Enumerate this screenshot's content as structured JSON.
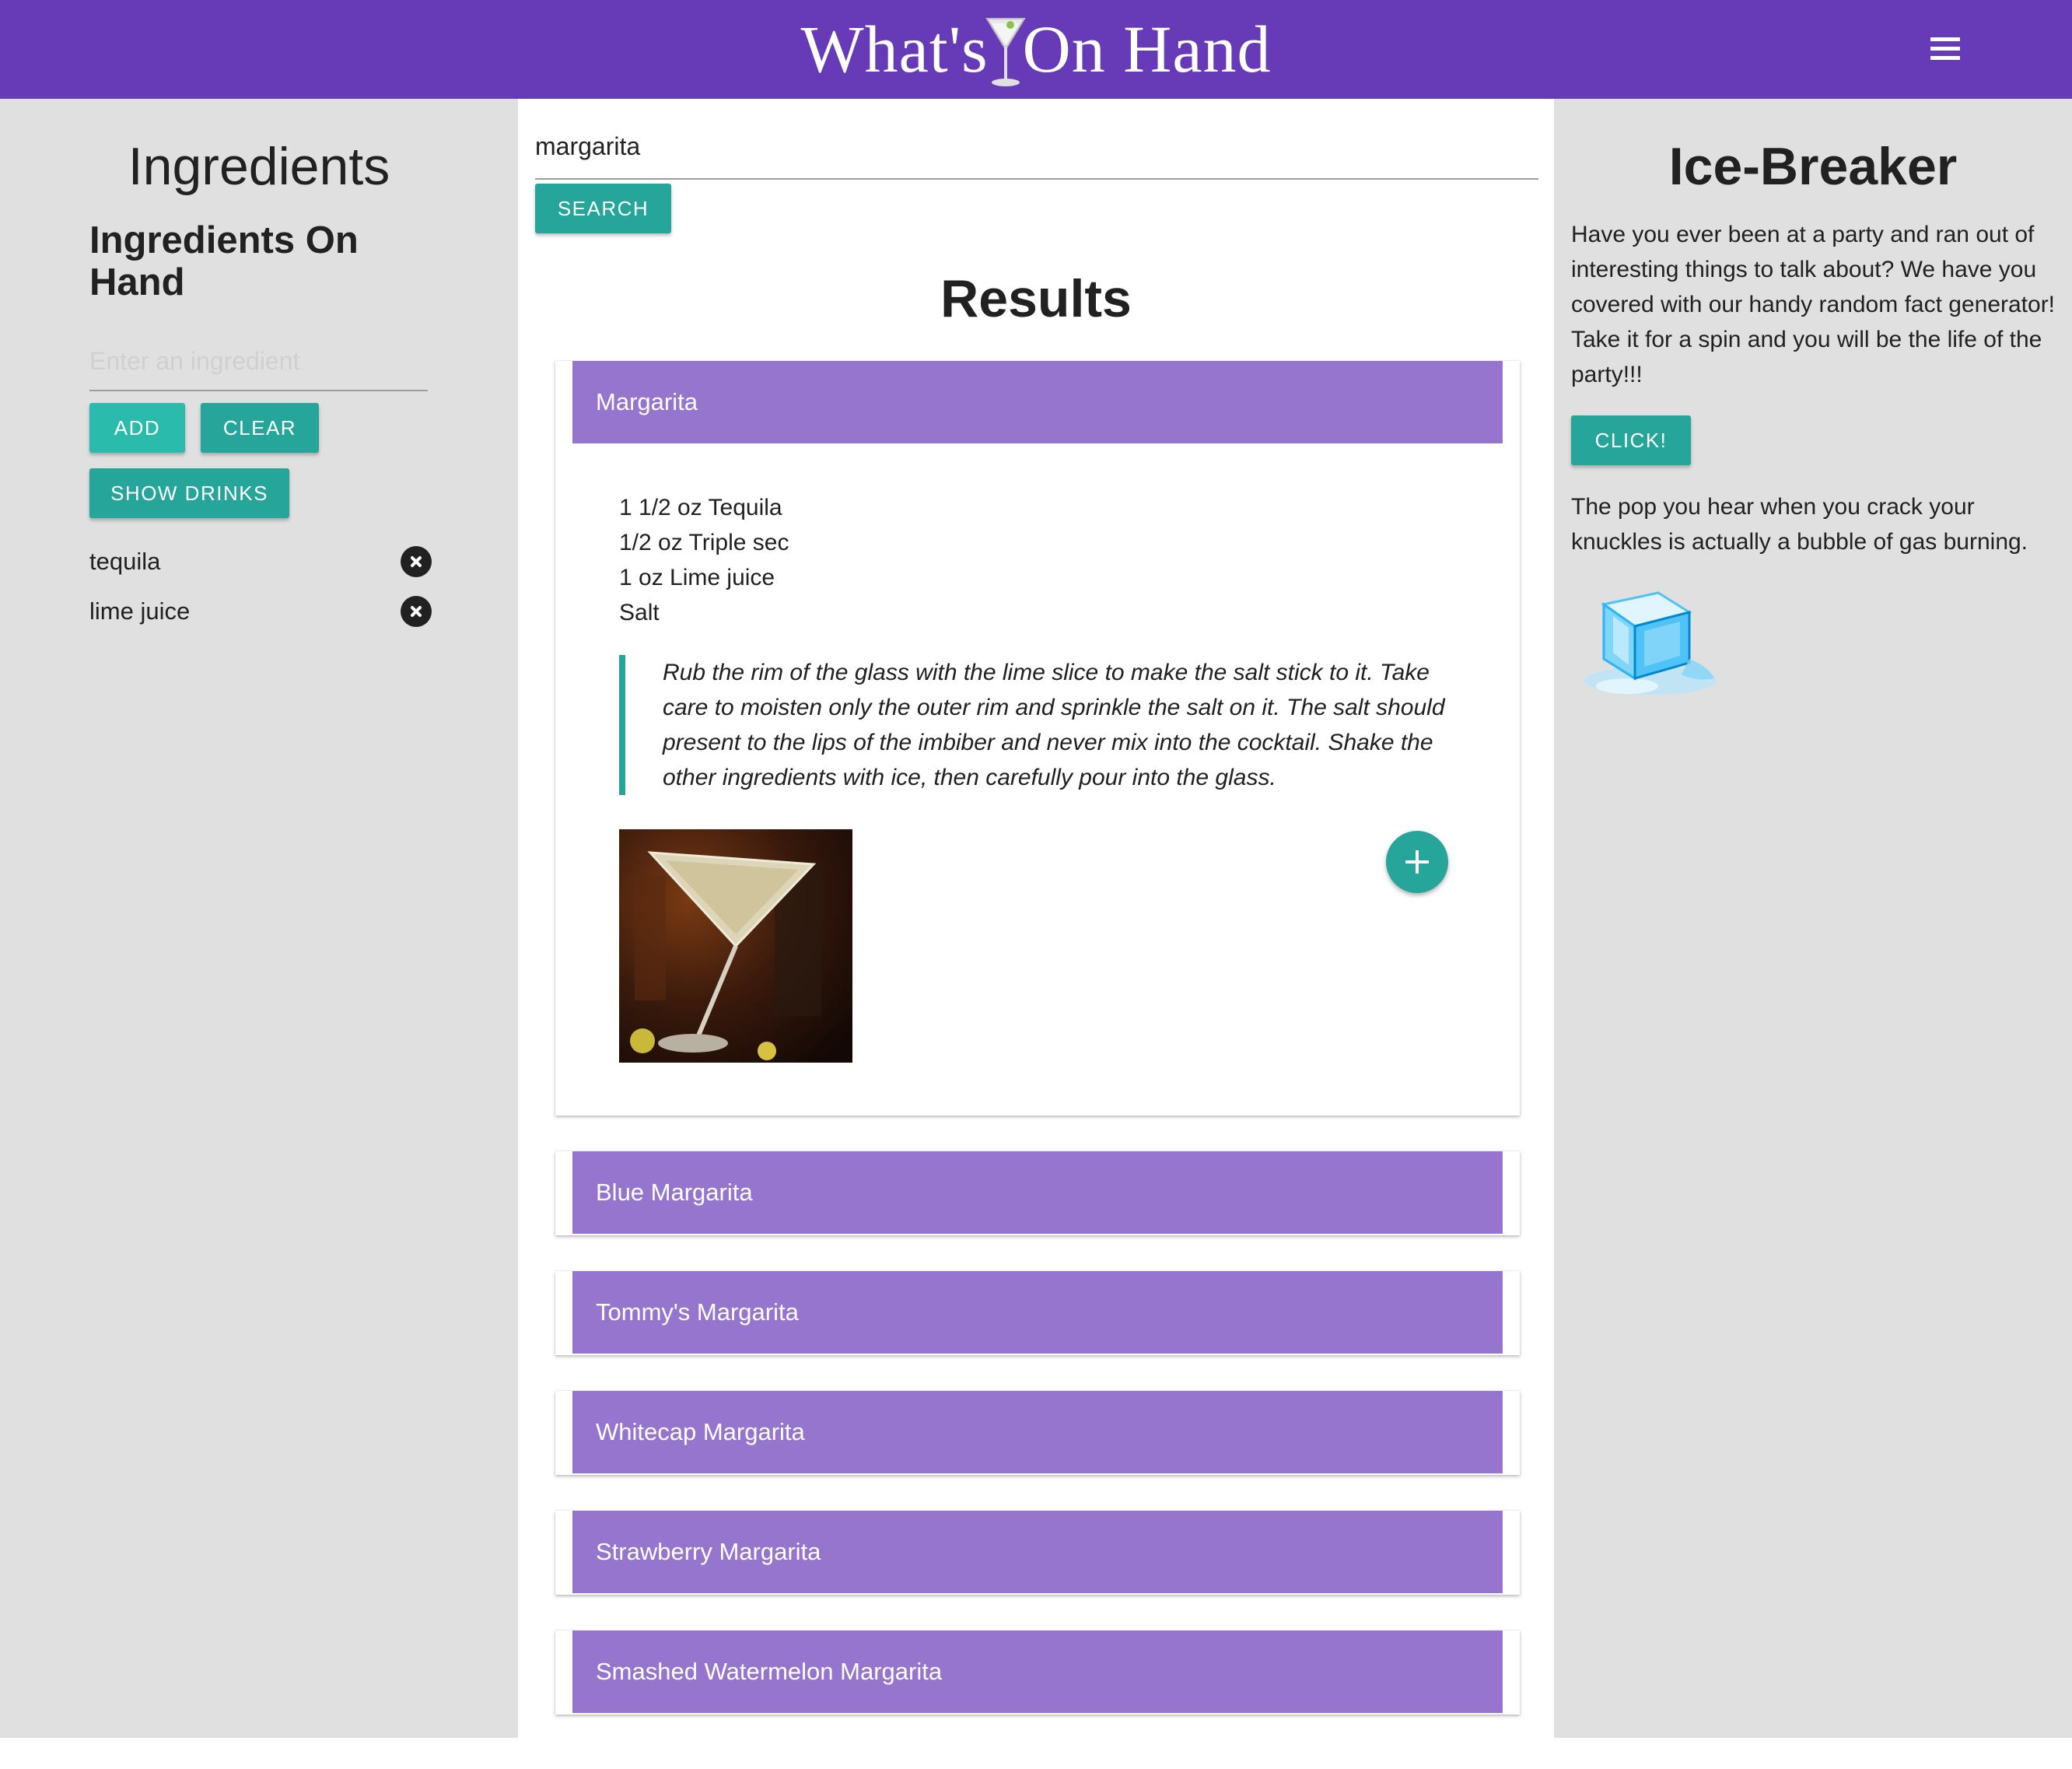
{
  "nav": {
    "brand_left": "What's",
    "brand_right": "On Hand",
    "logo_icon": "martini-glass-icon",
    "menu_icon": "hamburger-menu-icon"
  },
  "ingredients": {
    "title": "Ingredients",
    "subtitle": "Ingredients On Hand",
    "input_placeholder": "Enter an ingredient",
    "input_value": "",
    "add_label": "ADD",
    "clear_label": "CLEAR",
    "show_drinks_label": "SHOW DRINKS",
    "items": [
      {
        "label": "tequila"
      },
      {
        "label": "lime juice"
      }
    ]
  },
  "search": {
    "value": "margarita",
    "button_label": "SEARCH"
  },
  "results": {
    "title": "Results",
    "expanded": {
      "name": "Margarita",
      "ingredients": [
        "1 1/2 oz Tequila",
        "1/2 oz Triple sec",
        "1 oz Lime juice",
        "Salt"
      ],
      "instructions": "Rub the rim of the glass with the lime slice to make the salt stick to it. Take care to moisten only the outer rim and sprinkle the salt on it. The salt should present to the lips of the imbiber and never mix into the cocktail. Shake the other ingredients with ice, then carefully pour into the glass."
    },
    "collapsed": [
      {
        "name": "Blue Margarita"
      },
      {
        "name": "Tommy's Margarita"
      },
      {
        "name": "Whitecap Margarita"
      },
      {
        "name": "Strawberry Margarita"
      },
      {
        "name": "Smashed Watermelon Margarita"
      }
    ]
  },
  "icebreaker": {
    "title": "Ice-Breaker",
    "intro": "Have you ever been at a party and ran out of interesting things to talk about? We have you covered with our handy random fact generator! Take it for a spin and you will be the life of the party!!!",
    "button_label": "CLICK!",
    "fact": "The pop you hear when you crack your knuckles is actually a bubble of gas burning.",
    "image_icon": "ice-cube-icon"
  },
  "colors": {
    "nav": "#673ab7",
    "card_header": "#9575cd",
    "accent": "#26a69a",
    "side_bg": "#e0e0e0"
  }
}
